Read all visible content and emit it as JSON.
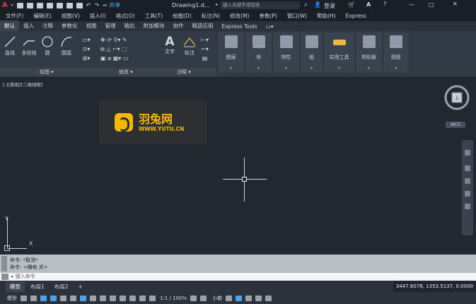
{
  "titlebar": {
    "doc_title": "Drawing1.d...",
    "search_placeholder": "键入关键字或短语",
    "share": "共享",
    "login": "登录"
  },
  "menu": [
    "文件(F)",
    "编辑(E)",
    "视图(V)",
    "插入(I)",
    "格式(O)",
    "工具(T)",
    "绘图(D)",
    "标注(N)",
    "修改(M)",
    "参数(P)",
    "窗口(W)",
    "帮助(H)",
    "Express"
  ],
  "tabs": [
    "默认",
    "插入",
    "注释",
    "参数化",
    "视图",
    "管理",
    "输出",
    "附加模块",
    "协作",
    "精选应用",
    "Express Tools"
  ],
  "ribbon": {
    "draw_tools": [
      "直线",
      "多段线",
      "圆",
      "圆弧"
    ],
    "draw_title": "绘图",
    "modify_title": "修改",
    "annot_tools": [
      "文字",
      "标注"
    ],
    "annot_title": "注释",
    "blocks": [
      "图层",
      "块",
      "特性",
      "组",
      "实用工具",
      "剪贴板",
      "视图"
    ]
  },
  "viewport_label": "[-][俯视][二维线框]",
  "logo": {
    "cn": "羽兔网",
    "url": "WWW.YUTU.CN"
  },
  "wcs": "WCS",
  "ucs": {
    "y": "Y",
    "x": "X"
  },
  "cmd": {
    "line1": "命令: *取消*",
    "line2": "命令: <栅格 关>",
    "placeholder": "键入命令"
  },
  "layout_tabs": [
    "模型",
    "布局1",
    "布局2"
  ],
  "coords": "3447.6078, 1353.5137, 0.0000",
  "status": {
    "model": "模型",
    "scale": "1:1 / 100%",
    "units": "小数"
  }
}
